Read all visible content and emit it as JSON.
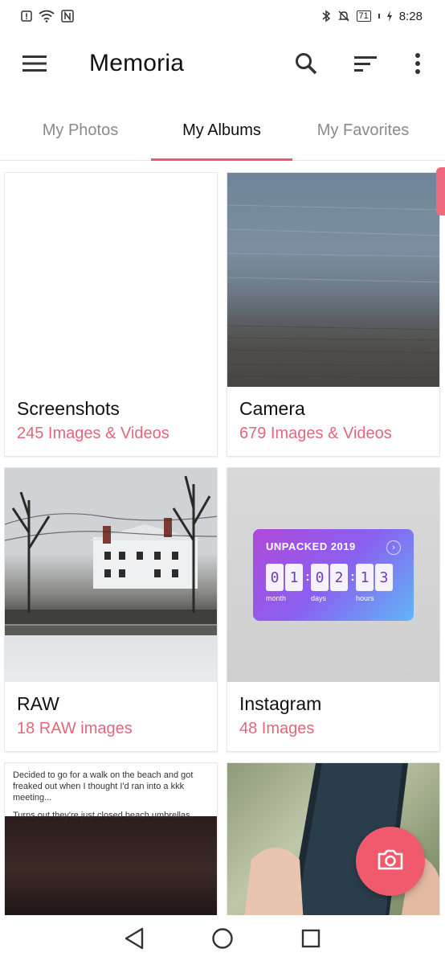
{
  "status": {
    "time": "8:28",
    "battery": "71"
  },
  "app_bar": {
    "title": "Memoria"
  },
  "tabs": [
    {
      "label": "My Photos",
      "active": false
    },
    {
      "label": "My Albums",
      "active": true
    },
    {
      "label": "My Favorites",
      "active": false
    }
  ],
  "albums": [
    {
      "title": "Screenshots",
      "count": "245 Images & Videos"
    },
    {
      "title": "Camera",
      "count": "679 Images & Videos"
    },
    {
      "title": "RAW",
      "count": "18 RAW images"
    },
    {
      "title": "Instagram",
      "count": "48 Images"
    }
  ],
  "instagram_promo": {
    "title": "UNPACKED 2019",
    "digits": [
      "0",
      "1",
      "0",
      "2",
      "1",
      "3"
    ],
    "units": [
      "month",
      "days",
      "hours"
    ]
  },
  "screenshot_tile": {
    "line1": "Decided to go for a walk on the beach and got freaked out when I thought I'd ran into a kkk meeting...",
    "line2": "Turns out they're just closed beach umbrellas."
  },
  "colors": {
    "accent": "#ec5b6e",
    "count_text": "#e3677b",
    "fab": "#f05a6c"
  },
  "icons": {
    "menu": "menu-icon",
    "search": "search-icon",
    "sort": "sort-icon",
    "more": "more-vertical-icon",
    "fab": "camera-icon"
  }
}
